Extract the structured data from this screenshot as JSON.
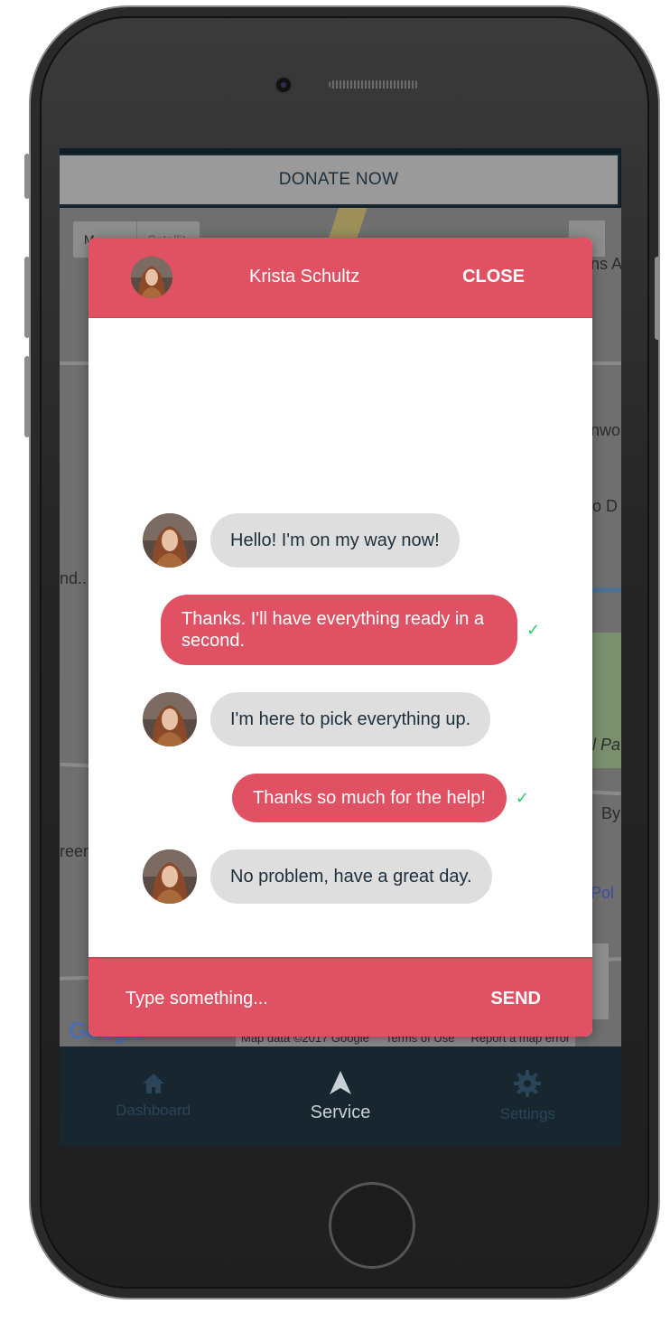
{
  "top_bar": {
    "donate_label": "DONATE NOW"
  },
  "map": {
    "type_map": "M",
    "type_satellite": "Satellit",
    "labels": [
      "ns A",
      "nwo",
      "o D",
      "nd..",
      "l Pa",
      "By",
      "reen",
      "Pol"
    ],
    "google": "Google",
    "footer": [
      "Map data ©2017 Google",
      "Terms of Use",
      "Report a map error"
    ]
  },
  "chat": {
    "contact_name": "Krista Schultz",
    "close_label": "CLOSE",
    "messages": [
      {
        "direction": "in",
        "text": "Hello! I'm on my way now!"
      },
      {
        "direction": "out",
        "text": "Thanks. I'll have everything ready in a second.",
        "status": "✓"
      },
      {
        "direction": "in",
        "text": "I'm here to pick everything up."
      },
      {
        "direction": "out",
        "text": "Thanks so much for the help!",
        "status": "✓"
      },
      {
        "direction": "in",
        "text": "No problem, have a great day."
      }
    ],
    "input_placeholder": "Type something...",
    "send_label": "SEND"
  },
  "tabbar": {
    "tabs": [
      {
        "label": "Dashboard",
        "icon": "home-icon",
        "active": false
      },
      {
        "label": "Service",
        "icon": "navigation-arrow-icon",
        "active": true
      },
      {
        "label": "Settings",
        "icon": "gear-icon",
        "active": false
      }
    ]
  },
  "colors": {
    "accent": "#e05263",
    "incoming_bubble": "#dedede",
    "tabbar_bg": "#17262f",
    "check": "#2ecc71"
  }
}
